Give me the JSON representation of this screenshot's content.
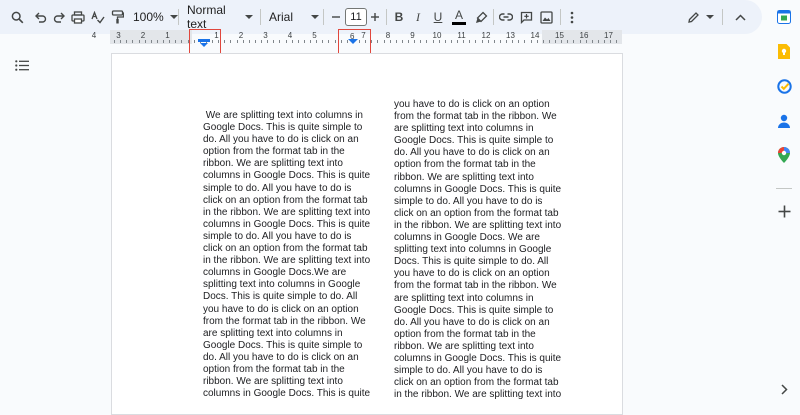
{
  "toolbar": {
    "zoom": "100%",
    "style": "Normal text",
    "font": "Arial",
    "font_size": "11",
    "icons": [
      "search-icon",
      "undo-icon",
      "redo-icon",
      "print-icon",
      "spellcheck-icon",
      "paint-format-icon",
      "minus-icon",
      "plus-icon",
      "bold-icon",
      "italic-icon",
      "underline-icon",
      "text-color-icon",
      "highlight-icon",
      "link-icon",
      "comment-icon",
      "image-icon",
      "more-icon",
      "edit-mode-icon",
      "collapse-icon"
    ],
    "bold_label": "B",
    "italic_label": "I",
    "underline_label": "U",
    "text_color_label": "A",
    "colors": {
      "accent": "#0b57d0",
      "toolbar_bg": "#edf2fa",
      "highlight_box": "#e0473d"
    }
  },
  "ruler": {
    "labels": [
      "4",
      "3",
      "2",
      "1",
      "1",
      "2",
      "3",
      "4",
      "5",
      "6",
      "7",
      "8",
      "9",
      "10",
      "11",
      "12",
      "13",
      "14",
      "15",
      "16",
      "17"
    ],
    "indent_marker": "left-indent-icon",
    "column_marker": "6"
  },
  "document": {
    "column1": " We are splitting text into columns in\nGoogle Docs. This is quite simple to\ndo. All you have to do is click on an\noption from the format tab in the\nribbon. We are splitting text into\ncolumns in Google Docs. This is quite\nsimple to do. All you have to do is\nclick on an option from the format tab\nin the ribbon. We are splitting text into\ncolumns in Google Docs. This is quite\nsimple to do. All you have to do is\nclick on an option from the format tab\nin the ribbon. We are splitting text into\ncolumns in Google Docs.We are\nsplitting text into columns in Google\nDocs. This is quite simple to do. All\nyou have to do is click on an option\nfrom the format tab in the ribbon. We\nare splitting text into columns in\nGoogle Docs. This is quite simple to\ndo. All you have to do is click on an\noption from the format tab in the\nribbon. We are splitting text into\ncolumns in Google Docs. This is quite",
    "column2": "you have to do is click on an option\nfrom the format tab in the ribbon. We\nare splitting text into columns in\nGoogle Docs. This is quite simple to\ndo. All you have to do is click on an\noption from the format tab in the\nribbon. We are splitting text into\ncolumns in Google Docs. This is quite\nsimple to do. All you have to do is\nclick on an option from the format tab\nin the ribbon. We are splitting text into\ncolumns in Google Docs. We are\nsplitting text into columns in Google\nDocs. This is quite simple to do. All\nyou have to do is click on an option\nfrom the format tab in the ribbon. We\nare splitting text into columns in\nGoogle Docs. This is quite simple to\ndo. All you have to do is click on an\noption from the format tab in the\nribbon. We are splitting text into\ncolumns in Google Docs. This is quite\nsimple to do. All you have to do is\nclick on an option from the format tab\nin the ribbon. We are splitting text into"
  },
  "side_panel": {
    "icons": [
      "calendar-icon",
      "keep-icon",
      "tasks-icon",
      "contacts-icon",
      "maps-icon",
      "add-icon",
      "expand-arrow-icon"
    ]
  }
}
